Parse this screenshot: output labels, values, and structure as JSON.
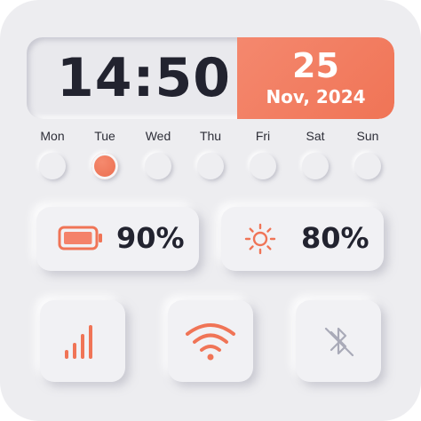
{
  "clock": {
    "time": "14:50",
    "day": "25",
    "month_year": "Nov, 2024"
  },
  "weekdays": [
    {
      "label": "Mon",
      "active": false
    },
    {
      "label": "Tue",
      "active": true
    },
    {
      "label": "Wed",
      "active": false
    },
    {
      "label": "Thu",
      "active": false
    },
    {
      "label": "Fri",
      "active": false
    },
    {
      "label": "Sat",
      "active": false
    },
    {
      "label": "Sun",
      "active": false
    }
  ],
  "battery": {
    "value": "90%",
    "icon": "battery-icon",
    "level": 0.9
  },
  "brightness": {
    "value": "80%",
    "icon": "sun-icon"
  },
  "toggles": {
    "cellular": {
      "icon": "signal-bars-icon",
      "enabled": true
    },
    "wifi": {
      "icon": "wifi-icon",
      "enabled": true
    },
    "bluetooth": {
      "icon": "bluetooth-icon",
      "enabled": false
    }
  },
  "colors": {
    "accent": "#F07456",
    "text": "#22232F",
    "background": "#EDEDF0",
    "inactive_icon": "#A9AAB8"
  }
}
